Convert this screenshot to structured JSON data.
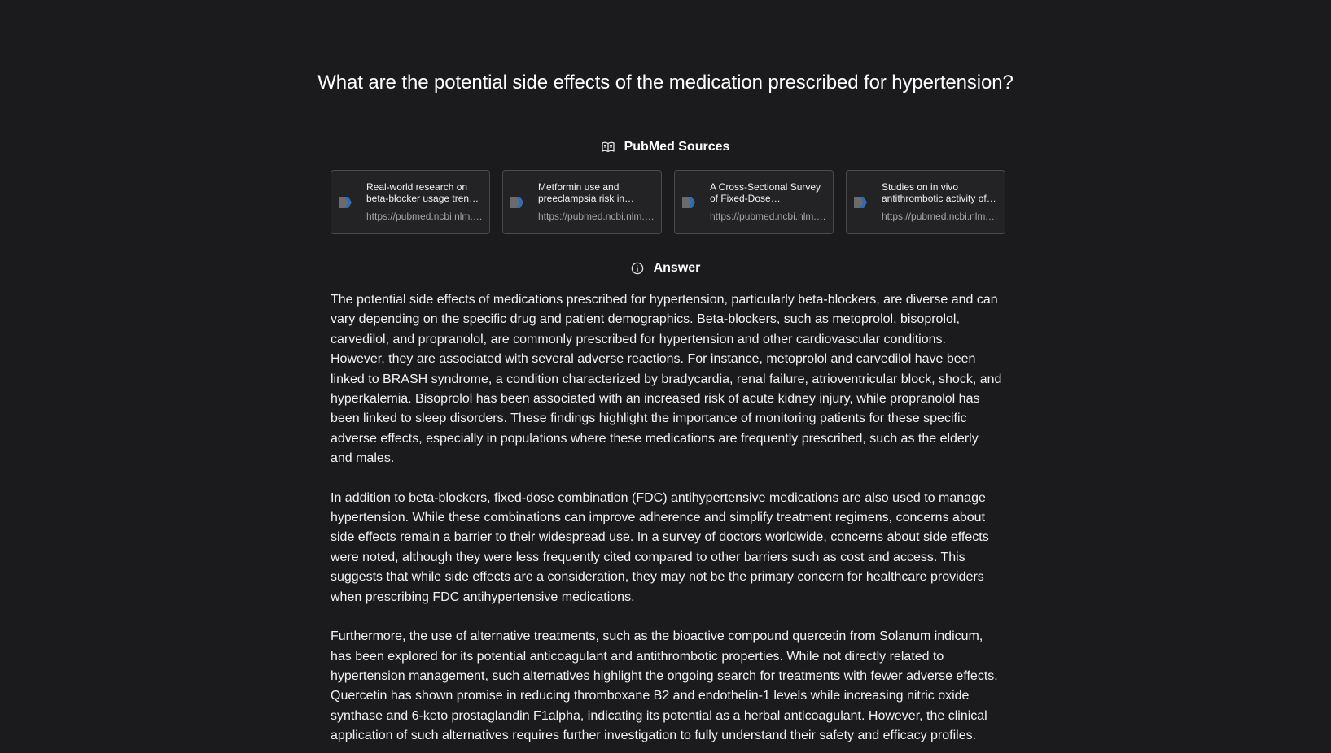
{
  "question": "What are the potential side effects of the medication prescribed for hypertension?",
  "sources_section": {
    "title": "PubMed Sources",
    "icon": "open-book-icon",
    "items": [
      {
        "title": "Real-world research on beta-blocker usage trends in China and safety exploration based on the FDA Adverse Event Reporting System (FAERS)",
        "url": "https://pubmed.ncbi.nlm.nih.gov/",
        "icon": "pubmed-logo-icon"
      },
      {
        "title": "Metformin use and preeclampsia risk in women with diabetes: a two-country cohort analysis",
        "url": "https://pubmed.ncbi.nlm.nih.gov/",
        "icon": "pubmed-logo-icon"
      },
      {
        "title": "A Cross-Sectional Survey of Fixed-Dose Combination Antihypertensive Medicines",
        "url": "https://pubmed.ncbi.nlm.nih.gov/",
        "icon": "pubmed-logo-icon"
      },
      {
        "title": "Studies on in vivo antithrombotic activity of quercetin from Solanum indicum",
        "url": "https://pubmed.ncbi.nlm.nih.gov/",
        "icon": "pubmed-logo-icon"
      }
    ]
  },
  "answer_section": {
    "title": "Answer",
    "icon": "info-circle-icon",
    "paragraphs": [
      "The potential side effects of medications prescribed for hypertension, particularly beta-blockers, are diverse and can vary depending on the specific drug and patient demographics. Beta-blockers, such as metoprolol, bisoprolol, carvedilol, and propranolol, are commonly prescribed for hypertension and other cardiovascular conditions. However, they are associated with several adverse reactions. For instance, metoprolol and carvedilol have been linked to BRASH syndrome, a condition characterized by bradycardia, renal failure, atrioventricular block, shock, and hyperkalemia. Bisoprolol has been associated with an increased risk of acute kidney injury, while propranolol has been linked to sleep disorders. These findings highlight the importance of monitoring patients for these specific adverse effects, especially in populations where these medications are frequently prescribed, such as the elderly and males.",
      "In addition to beta-blockers, fixed-dose combination (FDC) antihypertensive medications are also used to manage hypertension. While these combinations can improve adherence and simplify treatment regimens, concerns about side effects remain a barrier to their widespread use. In a survey of doctors worldwide, concerns about side effects were noted, although they were less frequently cited compared to other barriers such as cost and access. This suggests that while side effects are a consideration, they may not be the primary concern for healthcare providers when prescribing FDC antihypertensive medications.",
      "Furthermore, the use of alternative treatments, such as the bioactive compound quercetin from Solanum indicum, has been explored for its potential anticoagulant and antithrombotic properties. While not directly related to hypertension management, such alternatives highlight the ongoing search for treatments with fewer adverse effects. Quercetin has shown promise in reducing thromboxane B2 and endothelin-1 levels while increasing nitric oxide synthase and 6-keto prostaglandin F1alpha, indicating its potential as a herbal anticoagulant. However, the clinical application of such alternatives requires further investigation to fully understand their safety and efficacy profiles."
    ]
  },
  "colors": {
    "background": "#1b1b1d",
    "text": "#f2f2f2",
    "muted_text": "#a6a6a8",
    "card_border": "#4a4a4e",
    "pubmed_blue": "#2a6ebb",
    "pubmed_gray": "#6b6b6e"
  }
}
